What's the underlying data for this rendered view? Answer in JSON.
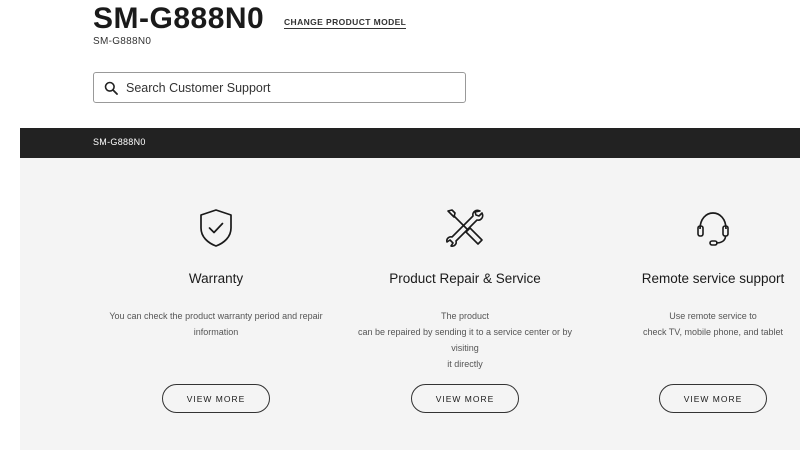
{
  "header": {
    "product_model": "SM-G888N0",
    "product_code": "SM-G888N0",
    "change_model_label": "CHANGE PRODUCT MODEL"
  },
  "search": {
    "placeholder": "Search Customer Support",
    "icon": "search-icon"
  },
  "bar": {
    "label": "SM-G888N0"
  },
  "cards": [
    {
      "icon": "shield-check-icon",
      "title": "Warranty",
      "desc": [
        "You can check the product warranty period and repair",
        "information"
      ],
      "button": "VIEW MORE"
    },
    {
      "icon": "tools-icon",
      "title": "Product Repair & Service",
      "desc": [
        "The product",
        "can be repaired by sending it to a service center or by visiting",
        "it directly"
      ],
      "button": "VIEW MORE"
    },
    {
      "icon": "headset-icon",
      "title": "Remote service support",
      "desc": [
        "Use remote service to",
        "check TV, mobile phone, and tablet"
      ],
      "button": "VIEW MORE"
    }
  ],
  "colors": {
    "bar_background": "#222222",
    "panel_background": "#f4f4f4"
  }
}
